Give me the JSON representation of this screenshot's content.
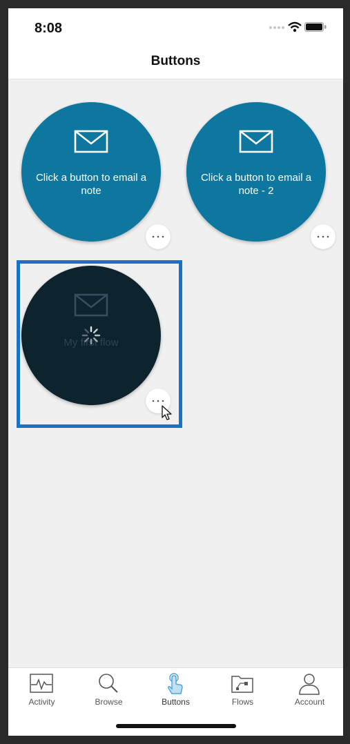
{
  "status_bar": {
    "time": "8:08"
  },
  "nav": {
    "title": "Buttons"
  },
  "buttons": [
    {
      "label": "Click a button to email a note",
      "state": "idle"
    },
    {
      "label": "Click a button to email a note - 2",
      "state": "idle"
    },
    {
      "label": "My first flow",
      "state": "running"
    }
  ],
  "tabs": [
    {
      "label": "Activity",
      "icon": "activity-icon"
    },
    {
      "label": "Browse",
      "icon": "search-icon"
    },
    {
      "label": "Buttons",
      "icon": "touch-icon"
    },
    {
      "label": "Flows",
      "icon": "flows-icon"
    },
    {
      "label": "Account",
      "icon": "person-icon"
    }
  ],
  "active_tab": "Buttons",
  "colors": {
    "button_blue": "#0d77a0",
    "button_running": "#0d232e",
    "selection_border": "#1a72c8",
    "active_tab_icon": "#4aa3d8"
  }
}
